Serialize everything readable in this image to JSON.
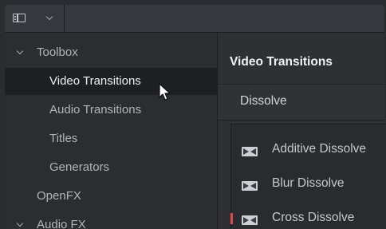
{
  "sidebar": {
    "items": [
      {
        "label": "Toolbox"
      },
      {
        "label": "Video Transitions"
      },
      {
        "label": "Audio Transitions"
      },
      {
        "label": "Titles"
      },
      {
        "label": "Generators"
      },
      {
        "label": "OpenFX"
      },
      {
        "label": "Audio FX"
      }
    ]
  },
  "content": {
    "title": "Video Transitions",
    "section": "Dissolve",
    "transitions": [
      {
        "label": "Additive Dissolve"
      },
      {
        "label": "Blur Dissolve"
      },
      {
        "label": "Cross Dissolve"
      }
    ]
  },
  "icons": {
    "panel_toggle": "sidebar-panel-icon",
    "expand": "chevron-down-icon",
    "transition": "transition-bowtie-icon",
    "cursor": "mouse-pointer-icon"
  },
  "colors": {
    "selected_bg": "#1e1f22",
    "panel_bg": "#2b2d31",
    "marker": "#e0484e"
  }
}
